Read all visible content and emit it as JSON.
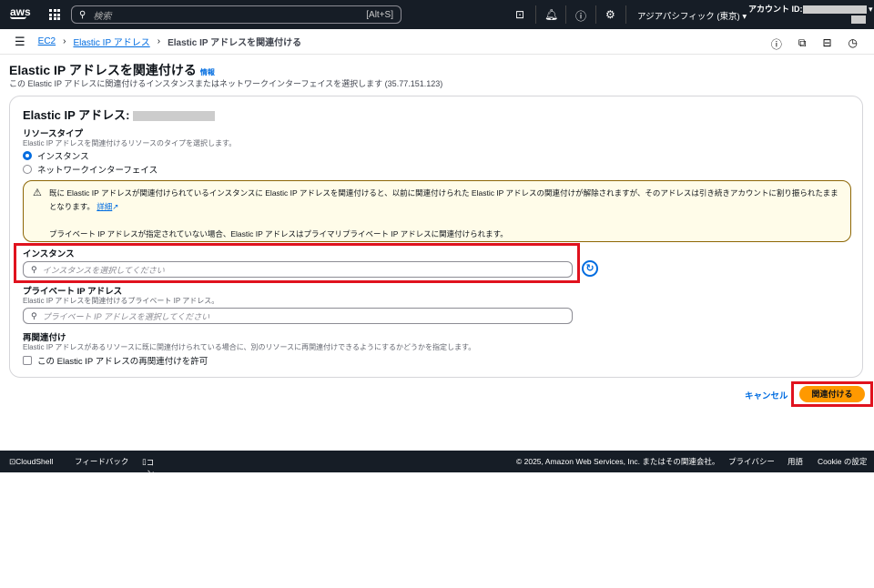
{
  "topnav": {
    "logo": "aws",
    "search_placeholder": "検索",
    "search_shortcut": "[Alt+S]",
    "region": "アジアパシフィック (東京) ▾",
    "account_label": "アカウント ID:"
  },
  "breadcrumb": [
    "EC2",
    "Elastic IP アドレス",
    "Elastic IP アドレスを関連付ける"
  ],
  "page": {
    "title": "Elastic IP アドレスを関連付ける",
    "info": "情報",
    "subtitle": "この Elastic IP アドレスに関連付けるインスタンスまたはネットワークインターフェイスを選択します (35.77.151.123)"
  },
  "form": {
    "card_title": "Elastic IP アドレス:",
    "resource_type_label": "リソースタイプ",
    "resource_type_desc": "Elastic IP アドレスを関連付けるリソースのタイプを選択します。",
    "options": [
      {
        "label": "インスタンス",
        "selected": true
      },
      {
        "label": "ネットワークインターフェイス",
        "selected": false
      }
    ],
    "alert_text": "既に Elastic IP アドレスが関連付けられているインスタンスに Elastic IP アドレスを関連付けると、以前に関連付けられた Elastic IP アドレスの関連付けが解除されますが、そのアドレスは引き続きアカウントに割り振られたままとなります。",
    "alert_link": "詳細",
    "alert_text2": "プライベート IP アドレスが指定されていない場合、Elastic IP アドレスはプライマリプライベート IP アドレスに関連付けられます。",
    "instance_label": "インスタンス",
    "instance_placeholder": "インスタンスを選択してください",
    "private_ip_label": "プライベート IP アドレス",
    "private_ip_desc": "Elastic IP アドレスを関連付けるプライベート IP アドレス。",
    "private_ip_placeholder": "プライベート IP アドレスを選択してください",
    "reassoc_label": "再関連付け",
    "reassoc_desc": "Elastic IP アドレスがあるリソースに既に関連付けられている場合に、別のリソースに再関連付けできるようにするかどうかを指定します。",
    "reassoc_checkbox": "この Elastic IP アドレスの再関連付けを許可",
    "reassoc_checked": false
  },
  "actions": {
    "cancel": "キャンセル",
    "associate": "関連付ける"
  },
  "footer": {
    "cloudshell": "CloudShell",
    "feedback": "フィードバック",
    "mobile": "コンソールモバイルアプリ",
    "copyright": "© 2025, Amazon Web Services, Inc. またはその関連会社。",
    "privacy": "プライバシー",
    "terms": "用語",
    "cookie": "Cookie の設定"
  },
  "colors": {
    "accent": "#006ce0",
    "primary_button": "#ff9900",
    "highlight": "#e0121e",
    "nav_bg": "#161d26"
  }
}
